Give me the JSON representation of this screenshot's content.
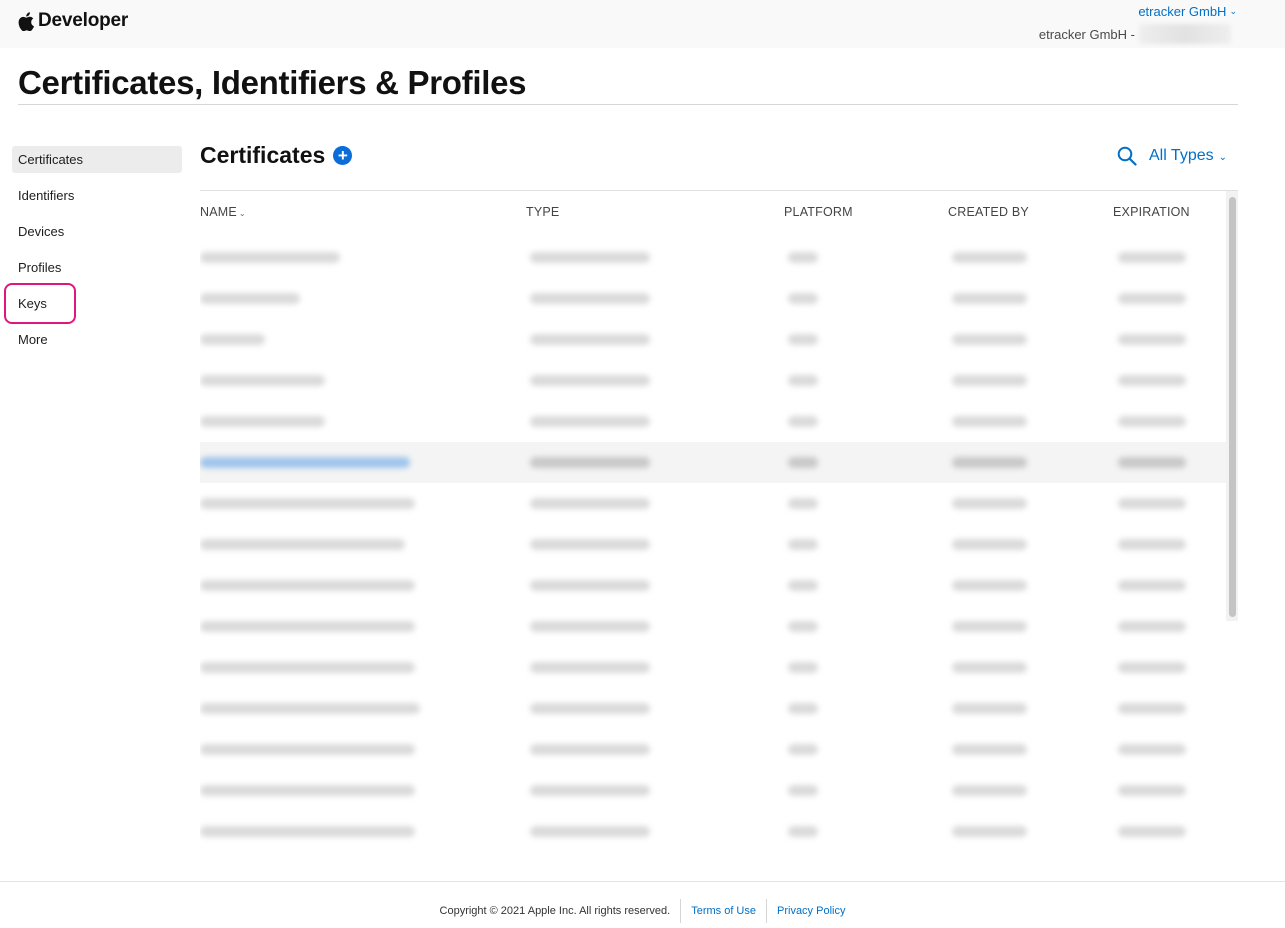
{
  "header": {
    "brand": "Developer",
    "account_name": "etracker GmbH",
    "team_label": "etracker GmbH -"
  },
  "page": {
    "title": "Certificates, Identifiers & Profiles"
  },
  "sidebar": {
    "items": [
      {
        "label": "Certificates",
        "active": true
      },
      {
        "label": "Identifiers"
      },
      {
        "label": "Devices"
      },
      {
        "label": "Profiles"
      },
      {
        "label": "Keys",
        "highlighted": true
      },
      {
        "label": "More"
      }
    ]
  },
  "section": {
    "title": "Certificates",
    "filter_label": "All Types"
  },
  "table": {
    "columns": [
      "NAME",
      "TYPE",
      "PLATFORM",
      "CREATED BY",
      "EXPIRATION"
    ],
    "sorted_column": "NAME",
    "selected_row": 5,
    "row_count": 15
  },
  "footer": {
    "copyright": "Copyright © 2021 Apple Inc. All rights reserved.",
    "terms": "Terms of Use",
    "privacy": "Privacy Policy"
  },
  "colors": {
    "accent": "#0070c9",
    "highlight": "#e0177a"
  },
  "icons": {
    "brand": "apple-logo-icon",
    "add": "plus-circle-icon",
    "search": "search-icon",
    "chevron": "chevron-down-icon"
  }
}
